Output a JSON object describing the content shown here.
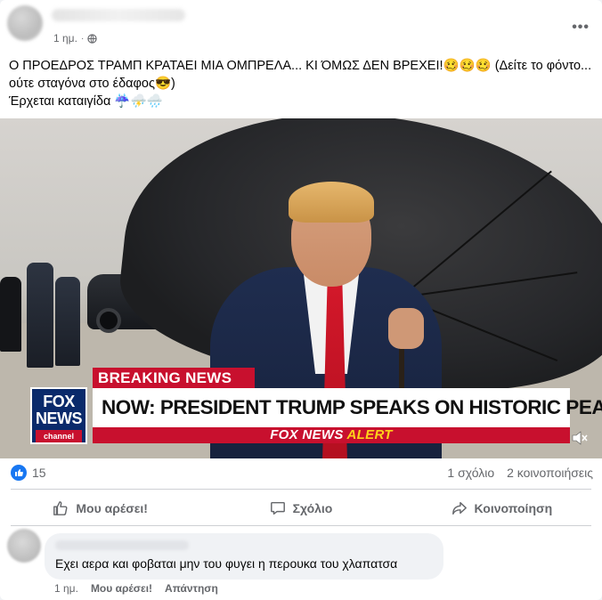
{
  "post": {
    "timestamp": "1 ημ.",
    "separator": "·",
    "text_line1": "Ο ΠΡΟΕΔΡΟΣ ΤΡΑΜΠ ΚΡΑΤΑΕΙ ΜΙΑ ΟΜΠΡΕΛΑ... ΚΙ ΌΜΩΣ ΔΕΝ ΒΡΕΧΕΙ!🥴🥴🥴 (Δείτε το φόντο...",
    "text_line2": "ούτε σταγόνα στο έδαφος😎)",
    "text_line3": "Έρχεται καταιγίδα ☔⛈️🌧️"
  },
  "video": {
    "breaking_label_1": "BREAKING ",
    "breaking_label_2": "NEWS",
    "logo_fox": "FOX",
    "logo_news": "NEWS",
    "logo_channel": "channel",
    "headline": "NOW: PRESIDENT TRUMP SPEAKS ON HISTORIC PEACE DEAL",
    "alert_brand": "FOX NEWS ",
    "alert_word": "ALERT"
  },
  "engagement": {
    "like_count": "15",
    "comments": "1 σχόλιο",
    "shares": "2 κοινοποιήσεις"
  },
  "actions": {
    "like": "Μου αρέσει!",
    "comment": "Σχόλιο",
    "share": "Κοινοποίηση"
  },
  "comment": {
    "text": "Εχει αερα και φοβαται μην του φυγει η περουκα του χλαπατσα",
    "time": "1 ημ.",
    "like": "Μου αρέσει!",
    "reply": "Απάντηση"
  },
  "colors": {
    "facebook_blue": "#1877f2",
    "fox_red": "#c8102e",
    "fox_navy": "#0a2a6b",
    "alert_yellow": "#ffd21a"
  },
  "icons": [
    "globe-icon",
    "more-options-icon",
    "like-badge-icon",
    "thumbs-up-icon",
    "comment-icon",
    "share-icon",
    "volume-icon"
  ]
}
